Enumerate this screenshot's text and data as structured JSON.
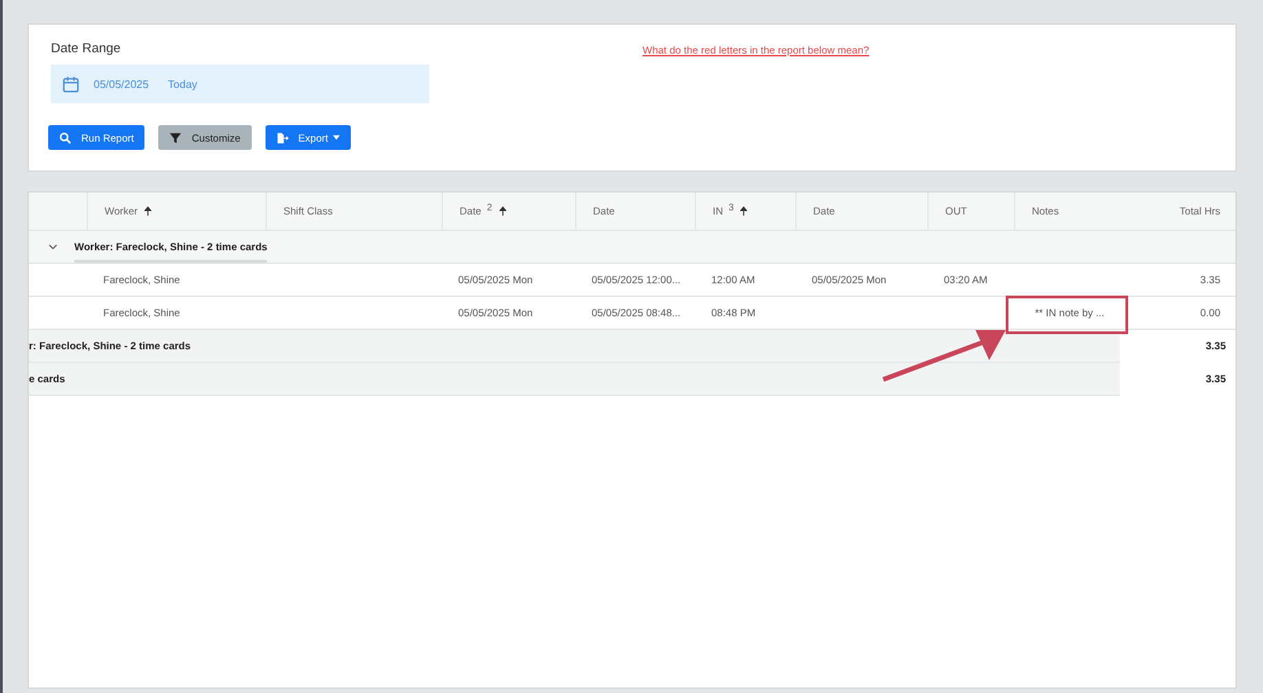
{
  "filter": {
    "label": "Date Range",
    "date": "05/05/2025",
    "range_name": "Today",
    "help_link": "What do the red letters in the report below mean?"
  },
  "buttons": [
    {
      "label": "Run Report",
      "kind": "search"
    },
    {
      "label": "Customize",
      "kind": "filter"
    },
    {
      "label": "Export",
      "kind": "export"
    }
  ],
  "table": {
    "columns": [
      {
        "kind": "spacer"
      },
      {
        "kind": "text",
        "label": "Worker",
        "sorted_ascending": true
      },
      {
        "kind": "text",
        "label": "Shift Class"
      },
      {
        "kind": "text",
        "label": "Date",
        "sorted_ascending": true,
        "sort_order": "2"
      },
      {
        "kind": "text",
        "label": "Date"
      },
      {
        "kind": "text",
        "label": "IN",
        "sorted_ascending": true,
        "sort_order": "3"
      },
      {
        "kind": "text",
        "label": "Date"
      },
      {
        "kind": "text",
        "label": "OUT"
      },
      {
        "kind": "text",
        "label": "Notes"
      },
      {
        "kind": "text",
        "label": "Total Hrs"
      }
    ],
    "group": {
      "label": "Worker: Fareclock, Shine - 2 time cards",
      "expanded": true
    },
    "rows": [
      {
        "worker": "Fareclock, Shine",
        "date": "05/05/2025 Mon",
        "in_date": "05/05/2025 12:00...",
        "in": "12:00 AM",
        "out_date": "05/05/2025 Mon",
        "out": "03:20 AM",
        "total": "3.35"
      },
      {
        "worker": "Fareclock, Shine",
        "date": "05/05/2025 Mon",
        "in_date": "05/05/2025 08:48...",
        "in": "08:48 PM",
        "notes": "** IN note by ...",
        "notes_highlighted": true,
        "total": "0.00"
      }
    ],
    "subtotal": {
      "label": "r: Fareclock, Shine - 2 time cards",
      "total": "3.35"
    },
    "grand_total": {
      "label": "e cards",
      "total": "3.35"
    }
  }
}
